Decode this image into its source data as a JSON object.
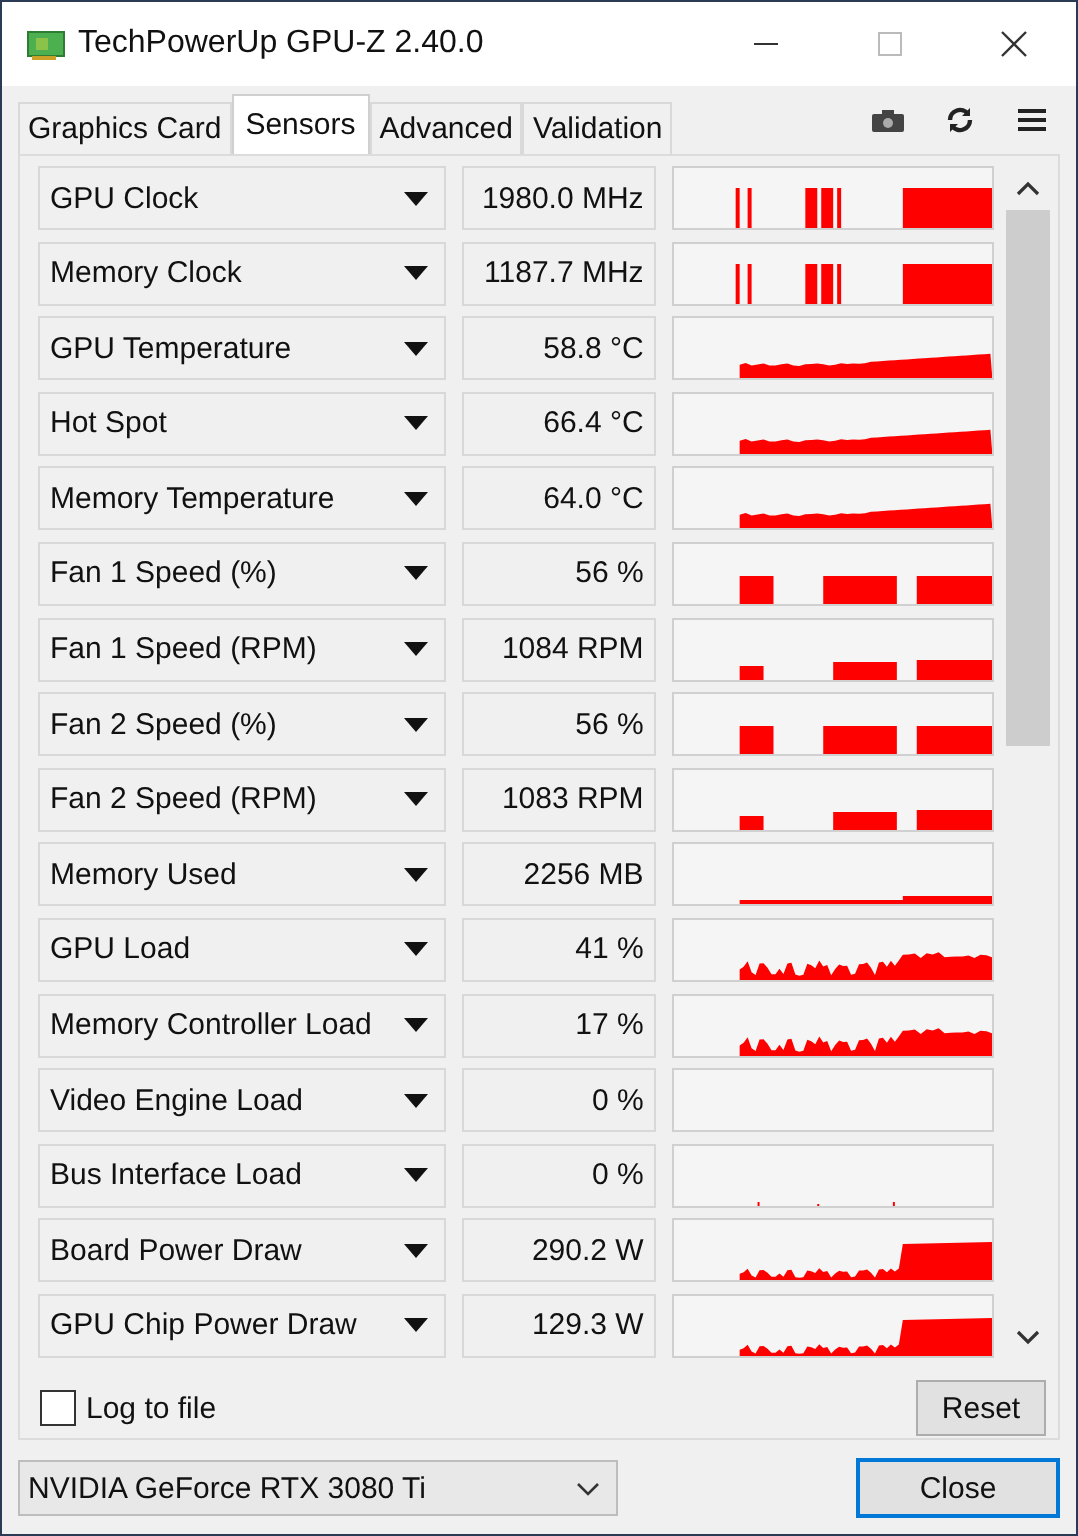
{
  "window": {
    "title": "TechPowerUp GPU-Z 2.40.0"
  },
  "tabs": [
    {
      "label": "Graphics Card",
      "selected": false
    },
    {
      "label": "Sensors",
      "selected": true
    },
    {
      "label": "Advanced",
      "selected": false
    },
    {
      "label": "Validation",
      "selected": false
    }
  ],
  "sensors": [
    {
      "name": "GPU Clock",
      "value": "1980.0 MHz",
      "kind": "spikes"
    },
    {
      "name": "Memory Clock",
      "value": "1187.7 MHz",
      "kind": "spikes"
    },
    {
      "name": "GPU Temperature",
      "value": "58.8 °C",
      "kind": "rising"
    },
    {
      "name": "Hot Spot",
      "value": "66.4 °C",
      "kind": "rising"
    },
    {
      "name": "Memory Temperature",
      "value": "64.0 °C",
      "kind": "rising"
    },
    {
      "name": "Fan 1 Speed (%)",
      "value": "56 %",
      "kind": "blocks"
    },
    {
      "name": "Fan 1 Speed (RPM)",
      "value": "1084 RPM",
      "kind": "steps"
    },
    {
      "name": "Fan 2 Speed (%)",
      "value": "56 %",
      "kind": "blocks"
    },
    {
      "name": "Fan 2 Speed (RPM)",
      "value": "1083 RPM",
      "kind": "steps"
    },
    {
      "name": "Memory Used",
      "value": "2256 MB",
      "kind": "flat"
    },
    {
      "name": "GPU Load",
      "value": "41 %",
      "kind": "noisy"
    },
    {
      "name": "Memory Controller Load",
      "value": "17 %",
      "kind": "noisy"
    },
    {
      "name": "Video Engine Load",
      "value": "0 %",
      "kind": "empty"
    },
    {
      "name": "Bus Interface Load",
      "value": "0 %",
      "kind": "sparse"
    },
    {
      "name": "Board Power Draw",
      "value": "290.2 W",
      "kind": "power"
    },
    {
      "name": "GPU Chip Power Draw",
      "value": "129.3 W",
      "kind": "power"
    }
  ],
  "log_to_file": {
    "label": "Log to file",
    "checked": false
  },
  "reset_button": "Reset",
  "device": "NVIDIA GeForce RTX 3080 Ti",
  "close_button": "Close"
}
